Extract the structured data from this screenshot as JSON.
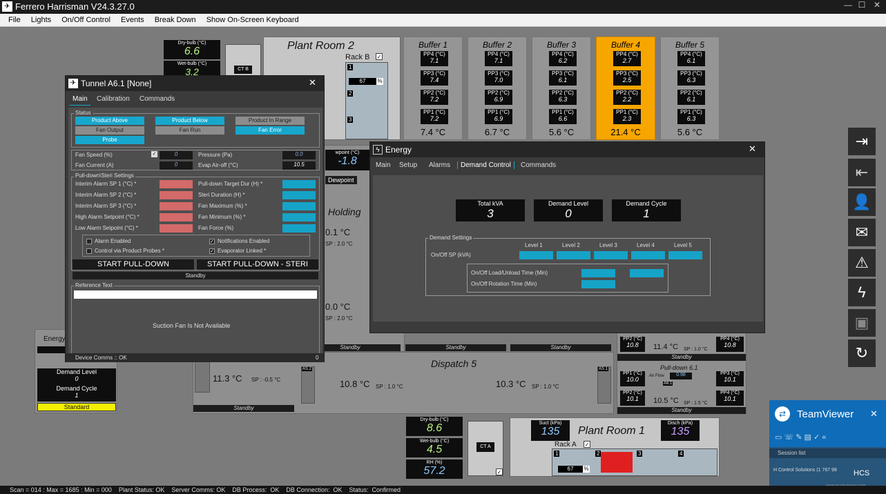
{
  "app": {
    "title": "Ferrero Harrisman V24.3.27.0"
  },
  "menu": [
    "File",
    "Lights",
    "On/Off Control",
    "Events",
    "Break Down",
    "Show On-Screen Keyboard"
  ],
  "top_weather": {
    "dry_label": "Dry-bulb (°C)",
    "dry_val": "6.6",
    "wet_label": "Wet-bulb (°C)",
    "wet_val": "3.2",
    "ct_label": "CT B"
  },
  "plant_room_2": {
    "title": "Plant Room 2",
    "rack": "Rack B",
    "pct": "67",
    "pct_unit": "%",
    "n1": "1",
    "n2": "2",
    "n3": "3"
  },
  "buffers": [
    {
      "name": "Buffer 1",
      "pp4": "7.1",
      "pp3": "7.4",
      "pp2": "7.2",
      "pp1": "7.2",
      "total": "7.4 °C",
      "active": false
    },
    {
      "name": "Buffer 2",
      "pp4": "7.1",
      "pp3": "7.0",
      "pp2": "6.9",
      "pp1": "6.9",
      "total": "6.7 °C",
      "active": false
    },
    {
      "name": "Buffer 3",
      "pp4": "6.2",
      "pp3": "6.1",
      "pp2": "6.3",
      "pp1": "6.6",
      "total": "5.6 °C",
      "active": false
    },
    {
      "name": "Buffer 4",
      "pp4": "2.7",
      "pp3": "2.5",
      "pp2": "2.2",
      "pp1": "2.3",
      "total": "21.4 °C",
      "active": true
    },
    {
      "name": "Buffer 5",
      "pp4": "6.1",
      "pp3": "6.3",
      "pp2": "6.1",
      "pp1": "6.3",
      "total": "5.6 °C",
      "active": false
    }
  ],
  "pp_labels": {
    "pp4": "PP4 (°C)",
    "pp3": "PP3 (°C)",
    "pp2": "PP2 (°C)",
    "pp1": "PP1 (°C)"
  },
  "tunnel": {
    "title": "Tunnel A6.1 [None]",
    "tabs": [
      "Main",
      "Calibration",
      "Commands"
    ],
    "status_label": "Status",
    "status_buttons": [
      "Product Above",
      "Product Below",
      "Product In Range",
      "Fan Output",
      "Fan Run",
      "Fan Error",
      "Probe"
    ],
    "fan_speed_label": "Fan Speed (%)",
    "fan_speed": "0",
    "fan_current_label": "Fan Current (A)",
    "fan_current": "0",
    "pressure_label": "Pressure (Pa)",
    "pressure": "0.0",
    "evap_label": "Evap Air-off (°C)",
    "evap": "10.5",
    "pulldown_label": "Pull-down\\Steri Settings",
    "left_settings": [
      "Interim Alarm SP 1 (°C) *",
      "Interim Alarm SP 2 (°C) *",
      "Interim Alarm SP 3 (°C) *",
      "High Alarm Setpoint (°C) *",
      "Low Alarm Setpoint (°C) *"
    ],
    "right_settings": [
      "Pull-down Target Dur (H) *",
      "Steri Duration (H) *",
      "Fan Maximum (%) *",
      "Fan Minimum (%) *",
      "Fan Force (%)"
    ],
    "checks": [
      "Alarm Enabled",
      "Control via Product Probes *",
      "Notifications Enabled",
      "Evaporator Linked *"
    ],
    "start_pull": "START PULL-DOWN",
    "start_steri": "START PULL-DOWN - STERI",
    "standby": "Standby",
    "ref_label": "Reference Text",
    "suction": "Suction Fan Is Not Available",
    "comms": "Device Comms :: OK",
    "comms_val": "0"
  },
  "energy": {
    "title": "Energy",
    "tabs": [
      "Main",
      "Setup",
      "Alarms",
      "Demand Control",
      "Commands"
    ],
    "total_kva_label": "Total kVA",
    "total_kva": "3",
    "demand_level_label": "Demand Level",
    "demand_level": "0",
    "demand_cycle_label": "Demand Cycle",
    "demand_cycle": "1",
    "settings_label": "Demand Settings",
    "levels": [
      "Level 1",
      "Level 2",
      "Level 3",
      "Level 4",
      "Level 5"
    ],
    "onoff_sp": "On/Off SP (kVA)",
    "load_time": "On/Off Load/Unload Time (Min)",
    "rotation_time": "On/Off Rotation Time (Min)"
  },
  "bg_energy_box": {
    "title": "Energy",
    "demand_level_label": "Demand Level",
    "demand_level": "0",
    "demand_cycle_label": "Demand Cycle",
    "demand_cycle": "1",
    "standard": "Standard"
  },
  "holding": {
    "title": "Holding",
    "t1": "0.1 °C",
    "sp1": "SP : 2.0 °C",
    "t2": "0.0 °C",
    "sp2": "SP : 2.0 °C",
    "dew": "Dewpoint",
    "dewpoint_lbl": "wpoint (°C)",
    "dewpoint_val": "-1.8"
  },
  "dispatch": {
    "title": "Dispatch 5",
    "t1": "11.3 °C",
    "sp1": "SP : -0.5 °C",
    "t2": "10.8 °C",
    "sp2": "SP : 1.0 °C",
    "t3": "10.3 °C",
    "sp3": "SP : 1.0 °C",
    "standby": "Standby",
    "as2": "AS.2",
    "as1": "AS.1"
  },
  "right_units": {
    "pp2_a": "10.8",
    "temp_a": "11.4 °C",
    "sp_a": "SP : 1.0 °C",
    "pp4_a": "10.8",
    "standby_a": "Standby",
    "pulldown": "Pull-down 6.1",
    "pp1": "10.0",
    "airflow_lbl": "Air Flow",
    "airflow": "0.98",
    "a61": "A6.1",
    "pp3": "10.1",
    "pp2_b": "10.1",
    "temp_b": "10.5 °C",
    "sp_b": "SP : 1.5 °C",
    "pp4_b": "10.1",
    "standby_b": "Standby"
  },
  "plant_room_1": {
    "title": "Plant Room 1",
    "suct_label": "Suct (kPa)",
    "suct": "135",
    "disch_label": "Disch (kPa)",
    "disch": "135",
    "rack": "Rack A",
    "pct": "67",
    "pct_unit": "%",
    "n1": "1",
    "n2": "2",
    "n3": "3",
    "n4": "4"
  },
  "bottom_weather": {
    "dry_label": "Dry-bulb (°C)",
    "dry_val": "8.6",
    "wet_label": "Wet-bulb (°C)",
    "wet_val": "4.5",
    "rh_label": "RH (%)",
    "rh_val": "57.2",
    "ct_label": "CT A"
  },
  "teamviewer": {
    "title": "TeamViewer",
    "session": "Session list",
    "org": "H Control Solutions (1 767 98",
    "url": "www.teamviewer.com",
    "hcs": "HCS"
  },
  "status_bar": "Scan = 014 : Max = 1685 : Min = 000    Plant Status: OK    Server Comms: OK    DB Process:  OK    DB Connection:  OK    Status:  Confirmed",
  "colors": {
    "accent": "#17a7cd",
    "buffer_active": "#f7a600",
    "alarm_red": "#d46a6a",
    "yellow": "#f5ef00"
  }
}
